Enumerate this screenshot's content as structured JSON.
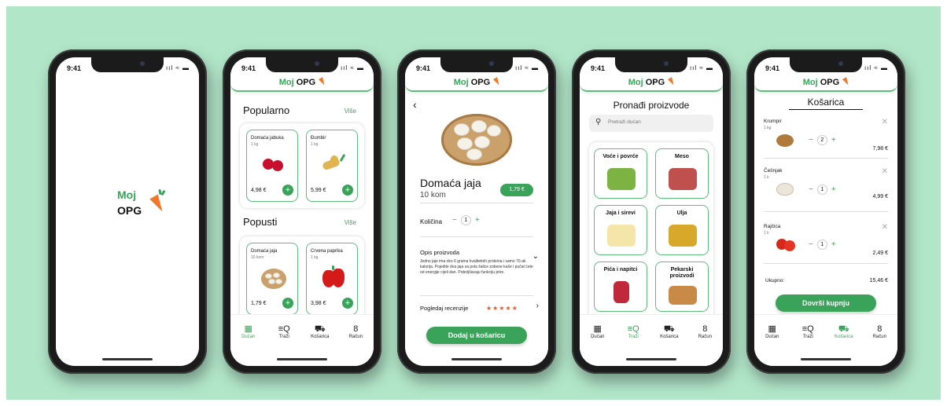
{
  "status": {
    "time": "9:41",
    "indicators": "ııl ≈ ▬"
  },
  "brand": {
    "part1": "Moj",
    "part2": "OPG"
  },
  "nav": [
    {
      "label": "Dućan",
      "icon": "▦"
    },
    {
      "label": "Traži",
      "icon": "≡Q"
    },
    {
      "label": "Košarica",
      "icon": "⛟"
    },
    {
      "label": "Račun",
      "icon": "8"
    }
  ],
  "shop": {
    "popular_title": "Popularno",
    "popular_more": "Više",
    "popular": [
      {
        "name": "Domaća jabuka",
        "qty": "1 kg",
        "price": "4,98 €",
        "img": "apple"
      },
      {
        "name": "Đumbir",
        "qty": "1 kg",
        "price": "5,99 €",
        "img": "ginger"
      }
    ],
    "discount_title": "Popusti",
    "discount_more": "Više",
    "discounts": [
      {
        "name": "Domaća jaja",
        "qty": "10 kom",
        "price": "1,79 €",
        "img": "eggs"
      },
      {
        "name": "Crvena paprika",
        "qty": "1 kg",
        "price": "3,98 €",
        "img": "pepper"
      }
    ],
    "plus": "+"
  },
  "detail": {
    "back": "‹",
    "title": "Domaća jaja",
    "subtitle": "10 kom",
    "price": "1,79 €",
    "qty_label": "Količina",
    "qty": "1",
    "minus": "−",
    "plus": "+",
    "desc_title": "Opis proizvoda",
    "desc": "Jedno jaje ima oko 6 grama kvalitetnih proteina i samo 70-ak kalorija. Pojedite dva jaja sa pola šalice zobene kaše i pučat ćete od energije cijeli dan. Poboljšavaju funkciju jetre.",
    "reviews": "Pogledaj recenzije",
    "stars": "★★★★★",
    "rating": 5,
    "chev_down": "⌄",
    "chev_right": "›",
    "add_button": "Dodaj u košaricu"
  },
  "search": {
    "title": "Pronađi proizvode",
    "placeholder": "Pretraži dućan",
    "search_icon": "⚲",
    "categories": [
      {
        "name": "Voće i povrće",
        "color": "#7cb342"
      },
      {
        "name": "Meso",
        "color": "#c0504d"
      },
      {
        "name": "Jaja i sirevi",
        "color": "#f4e6a8"
      },
      {
        "name": "Ulja",
        "color": "#d8a82a"
      },
      {
        "name": "Pića i napitci",
        "color": "#c0283b"
      },
      {
        "name": "Pekarski proizvodi",
        "color": "#c98a47"
      }
    ]
  },
  "cart": {
    "title": "Košarica",
    "items": [
      {
        "name": "Krumpir",
        "qty": "1 kg",
        "count": "2",
        "price": "7,98 €",
        "img": "#b07a3c"
      },
      {
        "name": "Češnjak",
        "qty": "1 k",
        "count": "1",
        "price": "4,99 €",
        "img": "#ece6da"
      },
      {
        "name": "Rajčica",
        "qty": "1 k",
        "count": "1",
        "price": "2,49 €",
        "img": "#d8281c"
      }
    ],
    "remove": "✕",
    "total_label": "Ukupno:",
    "total": "15,46 €",
    "button": "Dovrši kupnju"
  },
  "colors": {
    "accent": "#3aa35a",
    "background": "#b2e6c9",
    "carrot": "#f07828"
  }
}
